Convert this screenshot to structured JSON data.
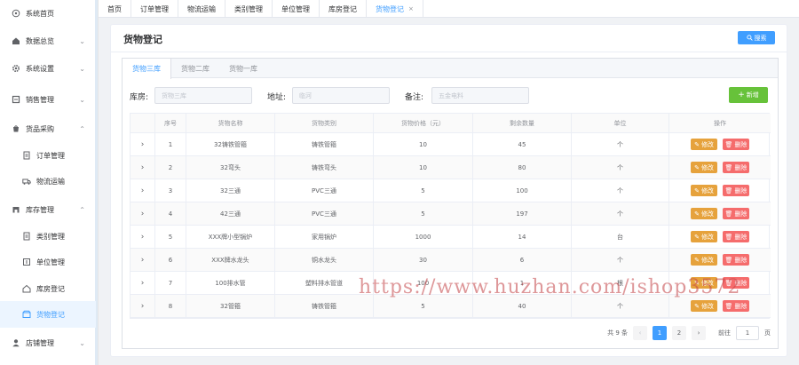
{
  "sidebar": {
    "items": [
      {
        "icon": "home-icon",
        "label": "系统首页",
        "chevron": ""
      },
      {
        "icon": "dashboard-icon",
        "label": "数据总览",
        "chevron": "⌄"
      },
      {
        "icon": "gear-icon",
        "label": "系统设置",
        "chevron": "⌄"
      },
      {
        "icon": "sales-icon",
        "label": "销售管理",
        "chevron": "⌄"
      },
      {
        "icon": "purchase-icon",
        "label": "货品采购",
        "chevron": "⌃"
      },
      {
        "icon": "order-icon",
        "label": "订单管理",
        "chevron": ""
      },
      {
        "icon": "truck-icon",
        "label": "物流运输",
        "chevron": ""
      },
      {
        "icon": "warehouse-icon",
        "label": "库存管理",
        "chevron": "⌃"
      },
      {
        "icon": "category-icon",
        "label": "类别管理",
        "chevron": ""
      },
      {
        "icon": "unit-icon",
        "label": "单位管理",
        "chevron": ""
      },
      {
        "icon": "storehouse-icon",
        "label": "库房登记",
        "chevron": ""
      },
      {
        "icon": "goods-icon",
        "label": "货物登记",
        "chevron": ""
      },
      {
        "icon": "user-icon",
        "label": "店铺管理",
        "chevron": "⌄"
      }
    ]
  },
  "tabs": [
    {
      "label": "首页"
    },
    {
      "label": "订单管理"
    },
    {
      "label": "物流运输"
    },
    {
      "label": "类别管理"
    },
    {
      "label": "单位管理"
    },
    {
      "label": "库房登记"
    },
    {
      "label": "货物登记",
      "close": "×"
    }
  ],
  "page": {
    "title": "货物登记",
    "search_label": "搜索",
    "inner_tabs": [
      "货物三库",
      "货物二库",
      "货物一库"
    ],
    "filters": {
      "warehouse_label": "库房:",
      "warehouse_value": "货物三库",
      "address_label": "地址:",
      "address_value": "临河",
      "remark_label": "备注:",
      "remark_value": "五金电料",
      "add_label": "新增"
    }
  },
  "table": {
    "columns": [
      "",
      "序号",
      "货物名称",
      "货物类别",
      "货物价格（元）",
      "剩余数量",
      "单位",
      "操作"
    ],
    "edit_label": "修改",
    "delete_label": "删除",
    "expand_glyph": "›",
    "rows": [
      {
        "no": "1",
        "name": "32铸铁管箍",
        "category": "铸铁管箍",
        "price": "10",
        "qty": "45",
        "unit": "个"
      },
      {
        "no": "2",
        "name": "32弯头",
        "category": "铸铁弯头",
        "price": "10",
        "qty": "80",
        "unit": "个"
      },
      {
        "no": "3",
        "name": "32三通",
        "category": "PVC三通",
        "price": "5",
        "qty": "100",
        "unit": "个"
      },
      {
        "no": "4",
        "name": "42三通",
        "category": "PVC三通",
        "price": "5",
        "qty": "197",
        "unit": "个"
      },
      {
        "no": "5",
        "name": "XXX牌小型锅炉",
        "category": "家用锅炉",
        "price": "1000",
        "qty": "14",
        "unit": "台"
      },
      {
        "no": "6",
        "name": "XXX牌水龙头",
        "category": "铜水龙头",
        "price": "30",
        "qty": "6",
        "unit": "个"
      },
      {
        "no": "7",
        "name": "100排水管",
        "category": "塑料排水管道",
        "price": "100",
        "qty": "1",
        "unit": "根"
      },
      {
        "no": "8",
        "name": "32管箍",
        "category": "铸铁管箍",
        "price": "5",
        "qty": "40",
        "unit": "个"
      }
    ]
  },
  "pagination": {
    "total_text": "共 9 条",
    "prev": "‹",
    "pages": [
      "1",
      "2"
    ],
    "next": "›",
    "goto_label": "前往",
    "goto_value": "1",
    "page_suffix": "页"
  },
  "watermark": "https://www.huzhan.com/ishop3572",
  "colors": {
    "primary": "#409eff",
    "success": "#67c23a",
    "warning": "#e6a23c",
    "danger": "#f56c6c"
  }
}
